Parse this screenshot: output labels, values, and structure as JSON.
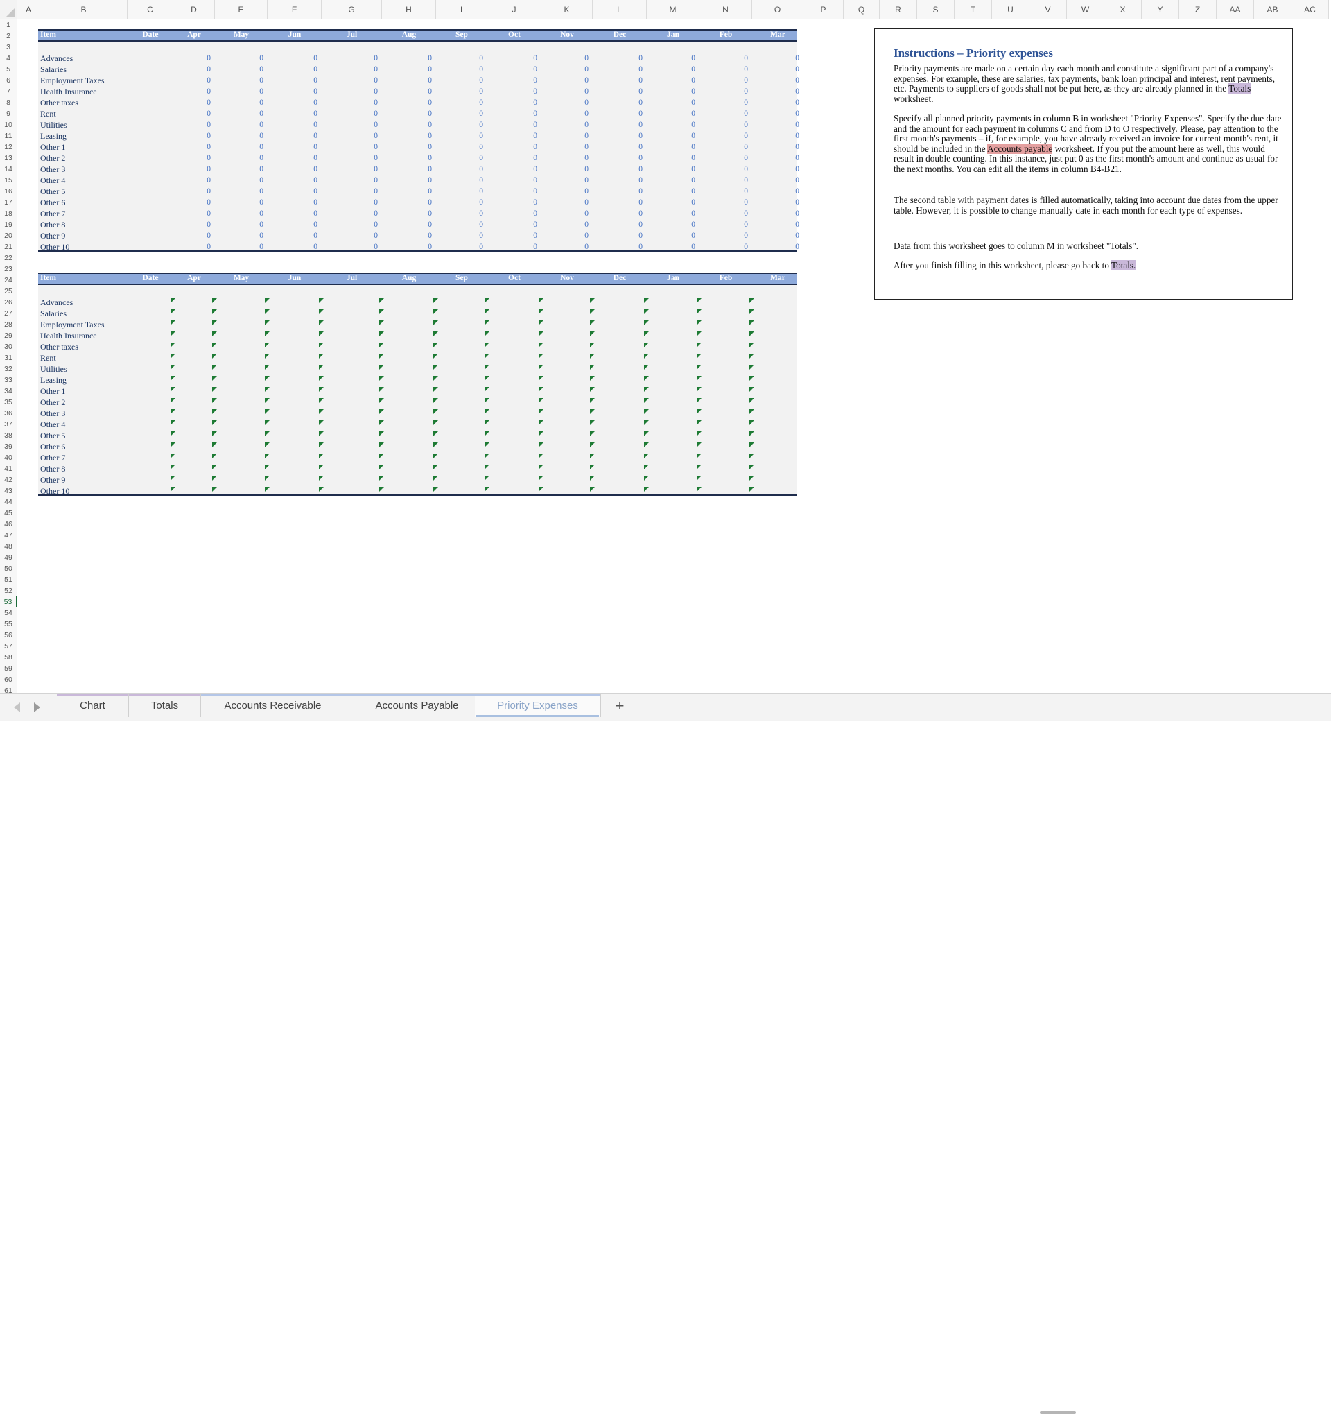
{
  "columns": [
    "A",
    "B",
    "C",
    "D",
    "E",
    "F",
    "G",
    "H",
    "I",
    "J",
    "K",
    "L",
    "M",
    "N",
    "O",
    "P",
    "Q",
    "R",
    "S",
    "T",
    "U",
    "V",
    "W",
    "X",
    "Y",
    "Z",
    "AA",
    "AB",
    "AC"
  ],
  "row_count": 61,
  "active_row": 53,
  "header_labels": [
    "Item",
    "Date",
    "Apr",
    "May",
    "Jun",
    "Jul",
    "Aug",
    "Sep",
    "Oct",
    "Nov",
    "Dec",
    "Jan",
    "Feb",
    "Mar"
  ],
  "items": [
    "Advances",
    "Salaries",
    "Employment Taxes",
    "Health Insurance",
    "Other taxes",
    "Rent",
    "Utilities",
    "Leasing",
    "Other 1",
    "Other 2",
    "Other 3",
    "Other 4",
    "Other 5",
    "Other 6",
    "Other 7",
    "Other 8",
    "Other 9",
    "Other 10"
  ],
  "zero_value": "0",
  "instructions": {
    "title": "Instructions – Priority expenses",
    "p1_a": "Priority payments are made on a certain day each month and constitute a significant part of a company's expenses. For example, these are salaries, tax payments, bank loan principal and interest, rent payments, etc. Payments to suppliers of goods shall not be put here, as they are already planned in the ",
    "p1_link": "Totals",
    "p1_b": " worksheet.",
    "p2_a": "Specify all planned priority payments in column B in worksheet \"Priority Expenses\". Specify the due date and the amount for each payment in columns C and from D to O  respectively. Please, pay attention to the first month's payments – if, for example, you have already received an invoice for current month's rent, it should be included in the ",
    "p2_link": "Accounts payable",
    "p2_b": " worksheet. If you put the amount here as well, this would result in double counting. In this instance, just put 0 as the first month's amount and continue as usual for the next months. You can edit all the items in column B4-B21.",
    "p3": "The second table with payment dates is filled automatically, taking into account due dates from the upper table. However, it is possible to change manually date in each month for each type of expenses.",
    "p4": "Data from this worksheet goes to column M in worksheet \"Totals\".",
    "p5_a": "After you finish filling in this worksheet, please go back to ",
    "p5_link": "Totals."
  },
  "tabs": [
    {
      "label": "Chart",
      "color": "#c9b8d9"
    },
    {
      "label": "Totals",
      "color": "#c9b8d9"
    },
    {
      "label": "Accounts Receivable",
      "color": "#b4c6e7"
    },
    {
      "label": "Accounts Payable",
      "color": "#b4c6e7"
    },
    {
      "label": "Priority Expenses",
      "color": "#b4c6e7"
    }
  ],
  "active_tab": "Priority Expenses",
  "add_tab_label": "+"
}
